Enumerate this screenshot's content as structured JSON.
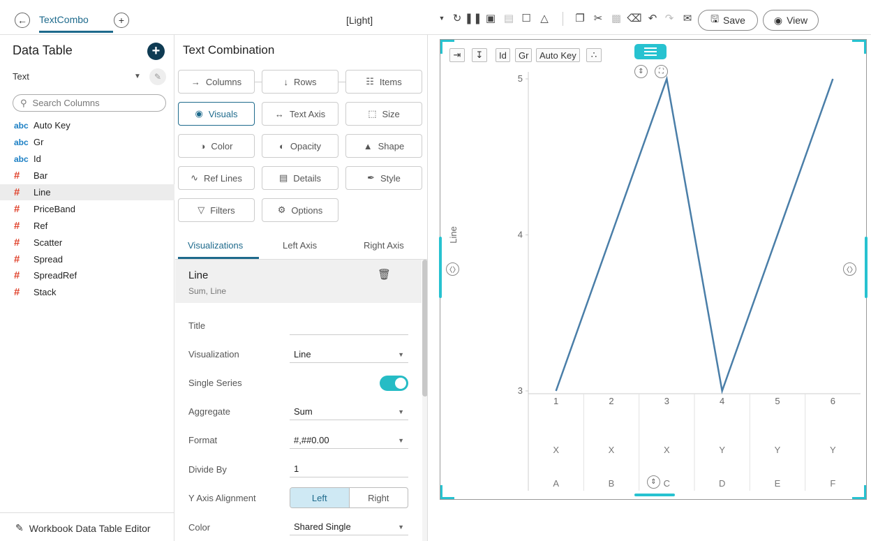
{
  "toolbar": {
    "back_icon": "back-arrow-icon",
    "tab_title": "TextCombo",
    "add_tab_icon": "plus-icon",
    "theme": "[Light]",
    "save_label": "Save",
    "view_label": "View"
  },
  "data_table": {
    "title": "Data Table",
    "source": "Text",
    "search_placeholder": "Search Columns",
    "columns": [
      {
        "type": "abc",
        "name": "Auto Key"
      },
      {
        "type": "abc",
        "name": "Gr"
      },
      {
        "type": "abc",
        "name": "Id"
      },
      {
        "type": "#",
        "name": "Bar"
      },
      {
        "type": "#",
        "name": "Line"
      },
      {
        "type": "#",
        "name": "PriceBand"
      },
      {
        "type": "#",
        "name": "Ref"
      },
      {
        "type": "#",
        "name": "Scatter"
      },
      {
        "type": "#",
        "name": "Spread"
      },
      {
        "type": "#",
        "name": "SpreadRef"
      },
      {
        "type": "#",
        "name": "Stack"
      }
    ],
    "selected_column": "Line",
    "footer": "Workbook Data Table Editor"
  },
  "visual_panel": {
    "title": "Text Combination",
    "buttons": {
      "columns": "Columns",
      "rows": "Rows",
      "items": "Items",
      "visuals": "Visuals",
      "text_axis": "Text Axis",
      "size": "Size",
      "color": "Color",
      "opacity": "Opacity",
      "shape": "Shape",
      "ref_lines": "Ref Lines",
      "details": "Details",
      "style": "Style",
      "filters": "Filters",
      "options": "Options"
    },
    "tabs": {
      "visualizations": "Visualizations",
      "left_axis": "Left Axis",
      "right_axis": "Right Axis"
    },
    "viz": {
      "name": "Line",
      "summary": "Sum, Line"
    },
    "props": {
      "title_label": "Title",
      "title_value": "",
      "visualization_label": "Visualization",
      "visualization_value": "Line",
      "single_series_label": "Single Series",
      "aggregate_label": "Aggregate",
      "aggregate_value": "Sum",
      "format_label": "Format",
      "format_value": "#,##0.00",
      "divide_by_label": "Divide By",
      "divide_by_value": "1",
      "y_axis_alignment_label": "Y Axis Alignment",
      "y_axis_left": "Left",
      "y_axis_right": "Right",
      "color_label": "Color",
      "color_value": "Shared Single"
    }
  },
  "chart_chips": {
    "id": "Id",
    "gr": "Gr",
    "auto_key": "Auto Key"
  },
  "colors": {
    "accent": "#1e6a8c",
    "handle": "#27c2d0",
    "line": "#4a7ea8"
  },
  "chart_data": {
    "type": "line",
    "ylabel": "Line",
    "ylim": [
      3,
      5
    ],
    "yticks": [
      3,
      4,
      5
    ],
    "categories": [
      "1",
      "2",
      "3",
      "4",
      "5",
      "6"
    ],
    "text_rows": [
      [
        "X",
        "X",
        "X",
        "Y",
        "Y",
        "Y"
      ],
      [
        "A",
        "B",
        "C",
        "D",
        "E",
        "F"
      ]
    ],
    "series": [
      {
        "values": [
          3,
          null,
          5,
          3,
          null,
          5
        ]
      }
    ],
    "grid": false
  }
}
